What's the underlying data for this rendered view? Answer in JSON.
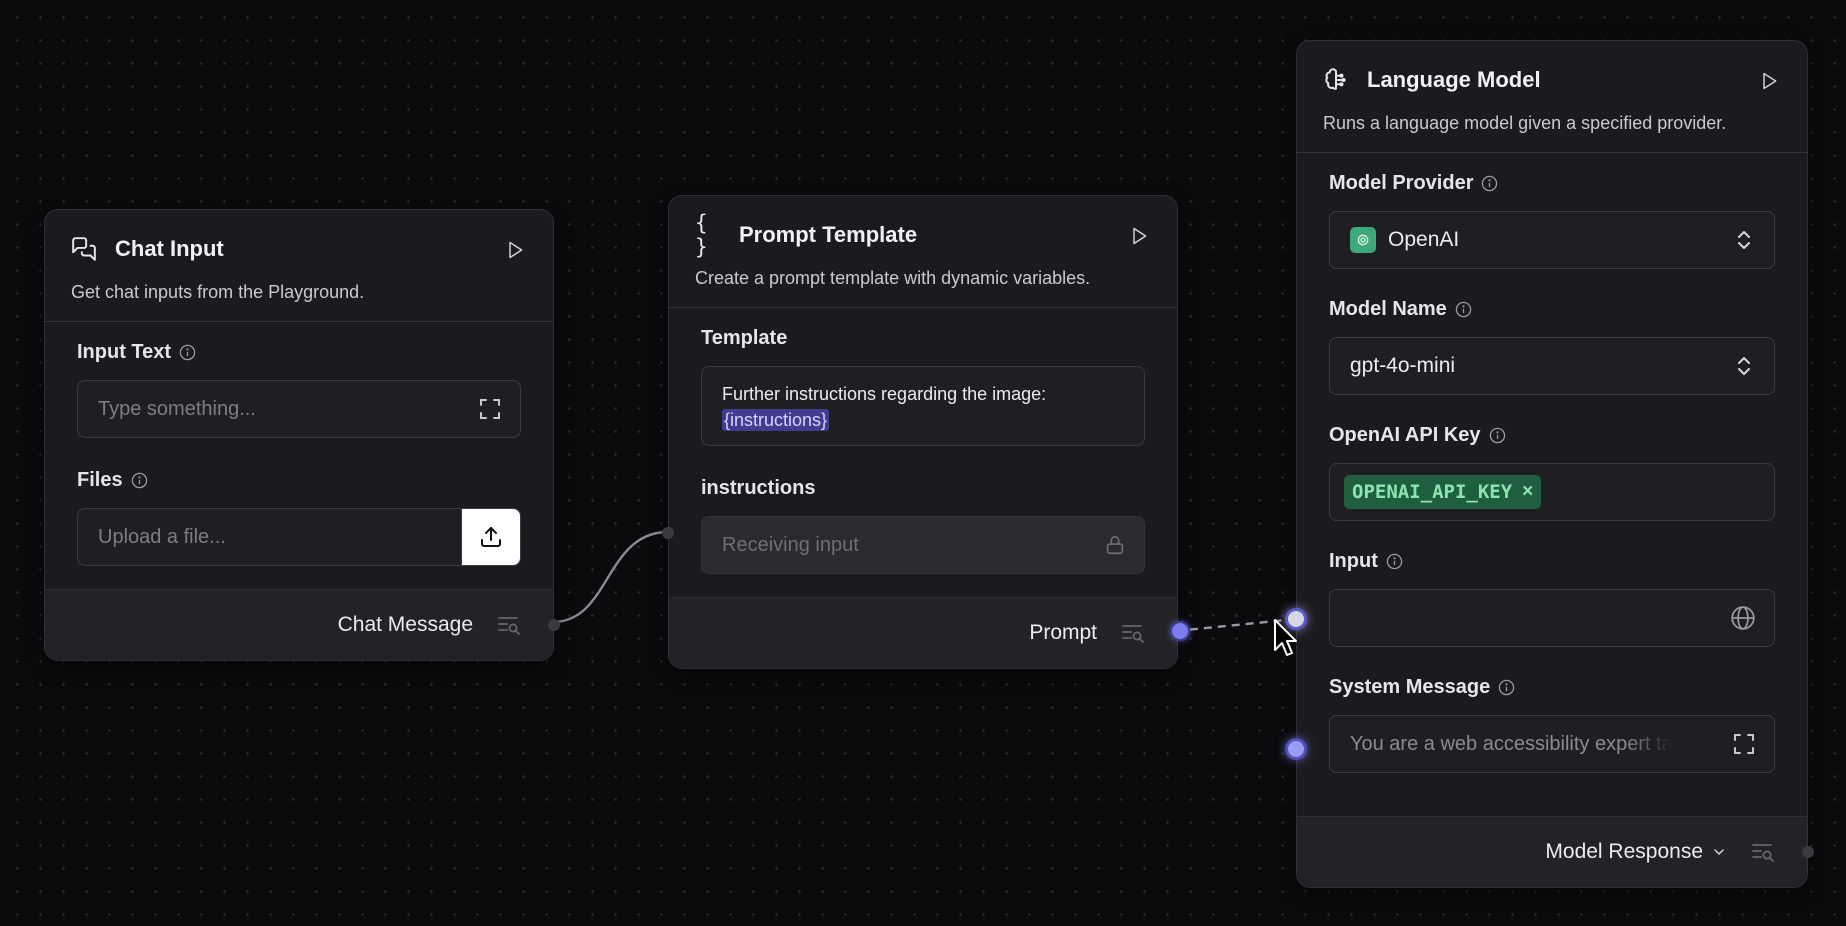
{
  "chat_input": {
    "title": "Chat Input",
    "description": "Get chat inputs from the Playground.",
    "input_text_label": "Input Text",
    "input_text_placeholder": "Type something...",
    "files_label": "Files",
    "files_placeholder": "Upload a file...",
    "output_label": "Chat Message"
  },
  "prompt_template": {
    "title": "Prompt Template",
    "icon_glyph": "{ }",
    "description": "Create a prompt template with dynamic variables.",
    "template_label": "Template",
    "template_text": "Further instructions regarding the image:",
    "template_variable": "{instructions}",
    "variable_label": "instructions",
    "variable_placeholder": "Receiving input",
    "output_label": "Prompt"
  },
  "language_model": {
    "title": "Language Model",
    "description": "Runs a language model given a specified provider.",
    "provider_label": "Model Provider",
    "provider_value": "OpenAI",
    "model_name_label": "Model Name",
    "model_name_value": "gpt-4o-mini",
    "api_key_label": "OpenAI API Key",
    "api_key_value": "OPENAI_API_KEY",
    "api_key_remove": "×",
    "input_label": "Input",
    "system_message_label": "System Message",
    "system_message_value": "You are a web accessibility expert ta",
    "output_label": "Model Response"
  },
  "colors": {
    "canvas": "#0b0b0d",
    "node": "#1b1b1f",
    "accent_handle": "#7b7cf0",
    "openai_green": "#3fa87a",
    "api_badge_bg": "#1f5f3f",
    "api_badge_text": "#8ee3b2"
  },
  "icons": {
    "chat_input": "messages-square-icon",
    "prompt_template": "braces-icon",
    "language_model": "brain-circuit-icon",
    "run": "play-icon",
    "info": "info-icon",
    "expand": "expand-icon",
    "upload": "upload-icon",
    "lock": "lock-icon",
    "globe": "globe-icon",
    "chevrons": "chevrons-up-down-icon",
    "inspect": "inspect-list-icon"
  }
}
